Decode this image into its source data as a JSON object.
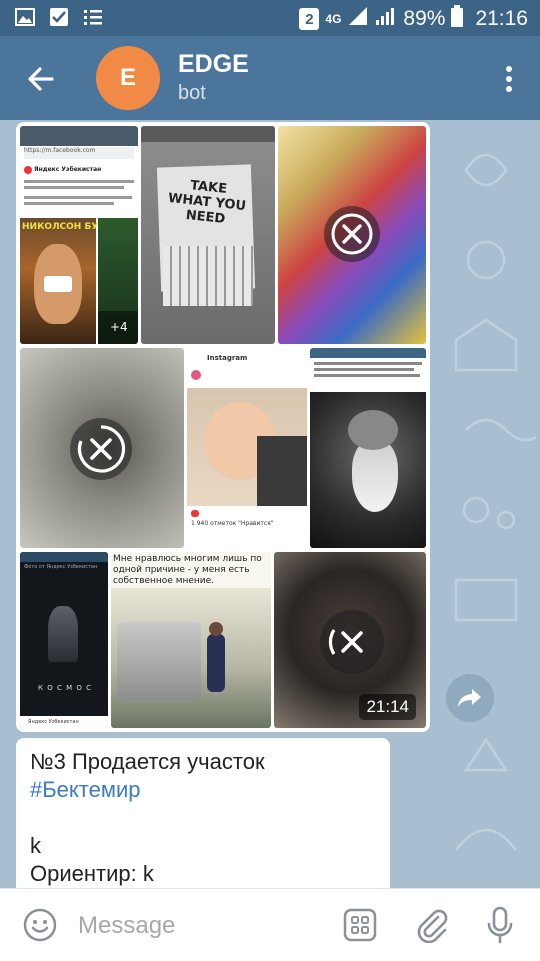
{
  "status_bar": {
    "network": "4G",
    "sim": "2",
    "battery": "89%",
    "time": "21:16"
  },
  "header": {
    "avatar_letter": "E",
    "title": "EDGE",
    "subtitle": "bot",
    "avatar_color": "#f08a45"
  },
  "album": {
    "photos": [
      {
        "name": "photo-facebook-post",
        "url_bar": "https://m.facebook.com",
        "source": "Яндекс Узбекистан",
        "banner": "НИКОЛСОН БУХАЕТ",
        "more_count": "+4"
      },
      {
        "name": "photo-take-what-you-need",
        "sign_text": "TAKE WHAT YOU NEED"
      },
      {
        "name": "photo-blurred-colorful",
        "downloadable": true
      },
      {
        "name": "photo-blurred-gray",
        "downloadable": true
      },
      {
        "name": "photo-baby",
        "header": "Instagram",
        "likes": "1 940 отметок \"Нравится\""
      },
      {
        "name": "photo-bearded-man"
      },
      {
        "name": "photo-poster-kosmos",
        "caption": "Фото от Яндекс Узбекистан",
        "poster_title": "К О С М О С",
        "footer": "Яндекс Узбекистан"
      },
      {
        "name": "photo-car",
        "caption": "Мне нравлюсь многим лишь по одной причине - у меня есть собственное мнение."
      },
      {
        "name": "photo-blurred-dark",
        "downloadable": true,
        "time": "21:14"
      }
    ]
  },
  "message": {
    "line1": "№3 Продается участок",
    "hashtag": "#Бектемир",
    "line3": "k",
    "line4": "Ориентир: k"
  },
  "input": {
    "placeholder": "Message"
  },
  "colors": {
    "status_bar": "#3c6487",
    "header": "#4b759a",
    "chat_bg": "#a7bfd1",
    "link": "#3a7cc3"
  }
}
